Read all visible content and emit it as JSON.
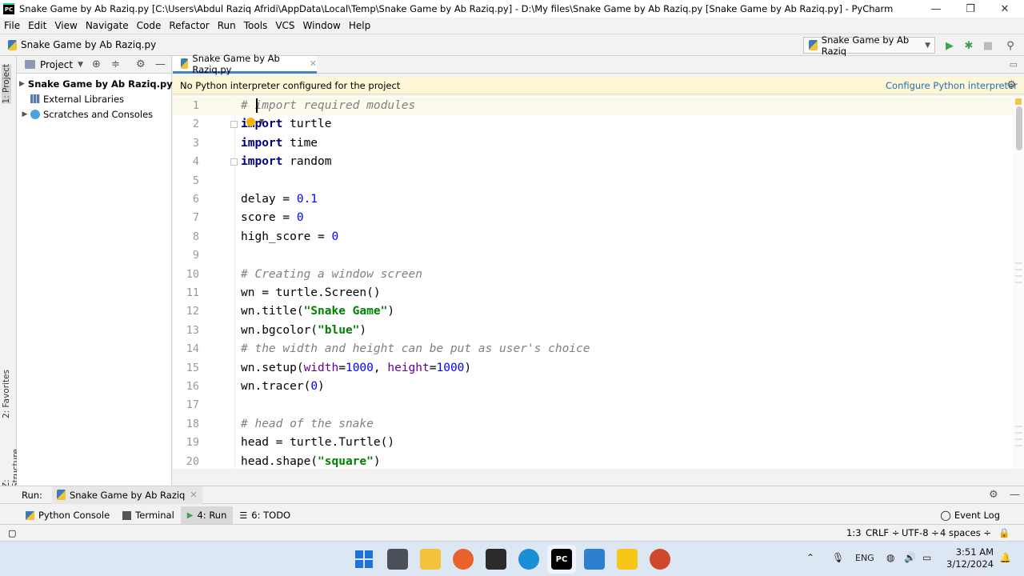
{
  "window": {
    "title": "Snake Game by Ab Raziq.py [C:\\Users\\Abdul Raziq Afridi\\AppData\\Local\\Temp\\Snake Game by Ab Raziq.py] - D:\\My files\\Snake Game by Ab Raziq.py [Snake Game by Ab Raziq.py] - PyCharm",
    "app_badge": "PC",
    "minimize": "—",
    "maximize": "❐",
    "close": "✕"
  },
  "menu": [
    "File",
    "Edit",
    "View",
    "Navigate",
    "Code",
    "Refactor",
    "Run",
    "Tools",
    "VCS",
    "Window",
    "Help"
  ],
  "navbar": {
    "breadcrumb": "Snake Game by Ab Raziq.py",
    "run_config": "Snake Game by Ab Raziq"
  },
  "left_strip": {
    "project_tab": "1: Project",
    "favorites_tab": "2: Favorites",
    "structure_tab": "Z: Structure"
  },
  "project_panel": {
    "title": "Project",
    "items": [
      {
        "label": "Snake Game by Ab Raziq.py"
      },
      {
        "label": "External Libraries"
      },
      {
        "label": "Scratches and Consoles"
      }
    ]
  },
  "editor": {
    "tab_label": "Snake Game by Ab Raziq.py",
    "banner_message": "No Python interpreter configured for the project",
    "banner_link": "Configure Python interpreter",
    "lines": [
      "1",
      "2",
      "3",
      "4",
      "5",
      "6",
      "7",
      "8",
      "9",
      "10",
      "11",
      "12",
      "13",
      "14",
      "15",
      "16",
      "17",
      "18",
      "19",
      "20"
    ]
  },
  "run_panel": {
    "label": "Run:",
    "tab": "Snake Game by Ab Raziq"
  },
  "bottom_tools": {
    "python_console": "Python Console",
    "terminal": "Terminal",
    "run": "4: Run",
    "todo": "6: TODO",
    "event_log": "Event Log"
  },
  "status": {
    "position": "1:3",
    "line_sep": "CRLF ÷",
    "encoding": "UTF-8 ÷",
    "indent": "4 spaces ÷"
  },
  "taskbar": {
    "language": "ENG",
    "time": "3:51 AM",
    "date": "3/12/2024"
  }
}
